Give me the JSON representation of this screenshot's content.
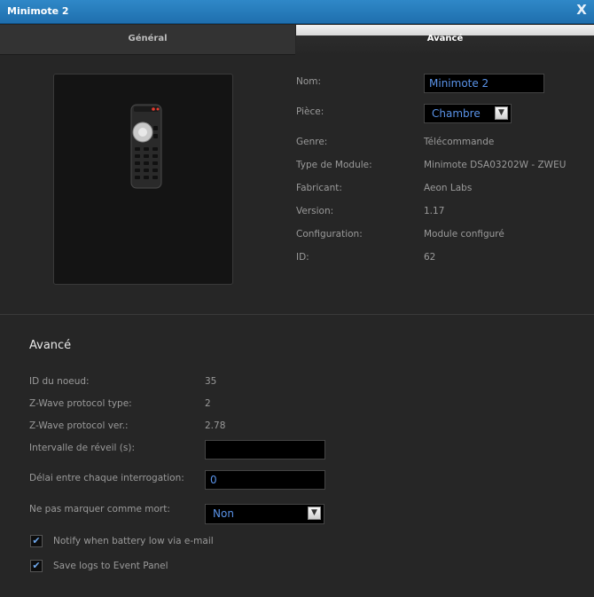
{
  "window": {
    "title": "Minimote 2",
    "close_glyph": "X"
  },
  "tabs": [
    {
      "label": "Général",
      "active": false
    },
    {
      "label": "Avancé",
      "active": true
    }
  ],
  "device": {
    "icon": "remote-control-image",
    "fields": {
      "nom_label": "Nom:",
      "nom_value": "Minimote 2",
      "piece_label": "Pièce:",
      "piece_value": "Chambre",
      "genre_label": "Genre:",
      "genre_value": "Télécommande",
      "type_label": "Type de Module:",
      "type_value": "Minimote DSA03202W - ZWEU",
      "fabricant_label": "Fabricant:",
      "fabricant_value": "Aeon Labs",
      "version_label": "Version:",
      "version_value": "1.17",
      "config_label": "Configuration:",
      "config_value": "Module configuré",
      "id_label": "ID:",
      "id_value": "62"
    }
  },
  "advanced": {
    "title": "Avancé",
    "node_id_label": "ID du noeud:",
    "node_id_value": "35",
    "protocol_type_label": "Z-Wave protocol type:",
    "protocol_type_value": "2",
    "protocol_ver_label": "Z-Wave protocol ver.:",
    "protocol_ver_value": "2.78",
    "wakeup_label": "Intervalle de réveil (s):",
    "wakeup_value": "",
    "poll_label": "Délai entre chaque interrogation:",
    "poll_value": "0",
    "dead_label": "Ne pas marquer comme mort:",
    "dead_value": "Non",
    "notify_label": "Notify when battery low via e-mail",
    "notify_checked": true,
    "logs_label": "Save logs to Event Panel",
    "logs_checked": true
  },
  "colors": {
    "accent": "#2a7fc1",
    "input_text": "#5a93e8",
    "background": "#262626"
  }
}
